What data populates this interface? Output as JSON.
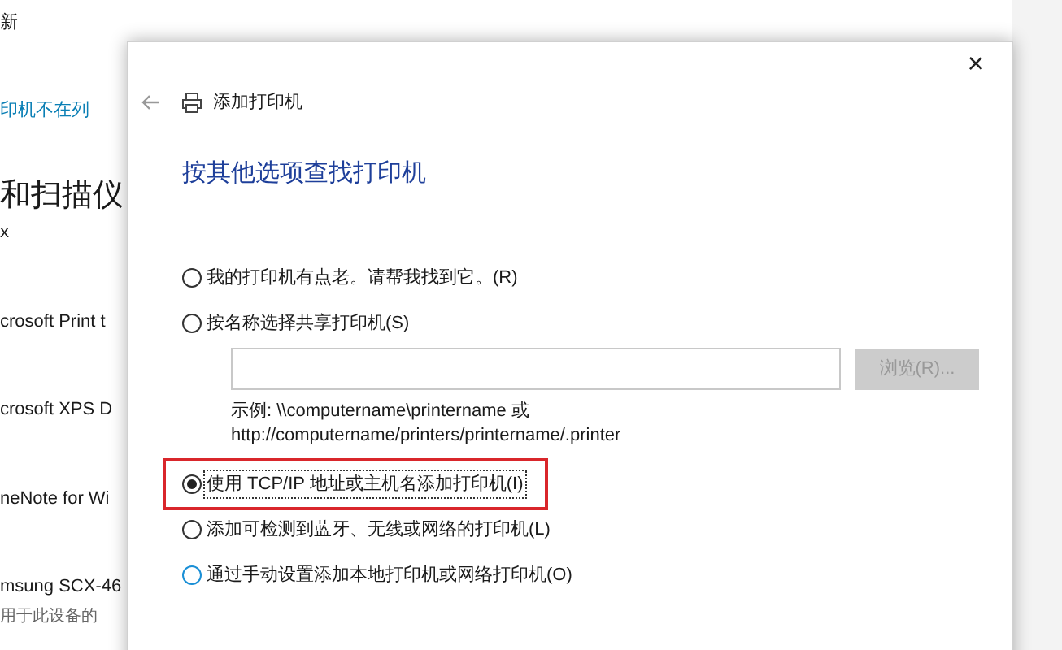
{
  "background_page": {
    "items": [
      {
        "kind": "text",
        "text": "新"
      },
      {
        "kind": "link",
        "text": "印机不在列"
      },
      {
        "kind": "heading",
        "text": "和扫描仪"
      },
      {
        "kind": "text",
        "text": "x"
      },
      {
        "kind": "device",
        "text": "crosoft Print t"
      },
      {
        "kind": "device",
        "text": "crosoft XPS D"
      },
      {
        "kind": "device",
        "text": "neNote for Wi"
      },
      {
        "kind": "device",
        "text": "msung SCX-46"
      },
      {
        "kind": "subtext",
        "text": "用于此设备的"
      }
    ]
  },
  "dialog": {
    "title": "添加打印机",
    "close": "×",
    "heading": "按其他选项查找打印机",
    "options": [
      {
        "kind": "radio",
        "label": "我的打印机有点老。请帮我找到它。(R)",
        "selected": false,
        "highlighted": false,
        "hovered": false
      },
      {
        "kind": "radio_with_field",
        "label": "按名称选择共享打印机(S)",
        "selected": false,
        "highlighted": false,
        "hovered": false,
        "browse_button": {
          "label": "浏览(R)...",
          "disabled": true
        },
        "example": [
          "示例: \\\\computername\\printername 或",
          "http://computername/printers/printername/.printer"
        ]
      },
      {
        "kind": "radio",
        "label": "使用 TCP/IP 地址或主机名添加打印机(I)",
        "selected": true,
        "highlighted": true,
        "hovered": false
      },
      {
        "kind": "radio",
        "label": "添加可检测到蓝牙、无线或网络的打印机(L)",
        "selected": false,
        "highlighted": false,
        "hovered": false
      },
      {
        "kind": "radio",
        "label": "通过手动设置添加本地打印机或网络打印机(O)",
        "selected": false,
        "highlighted": false,
        "hovered": true
      }
    ]
  }
}
